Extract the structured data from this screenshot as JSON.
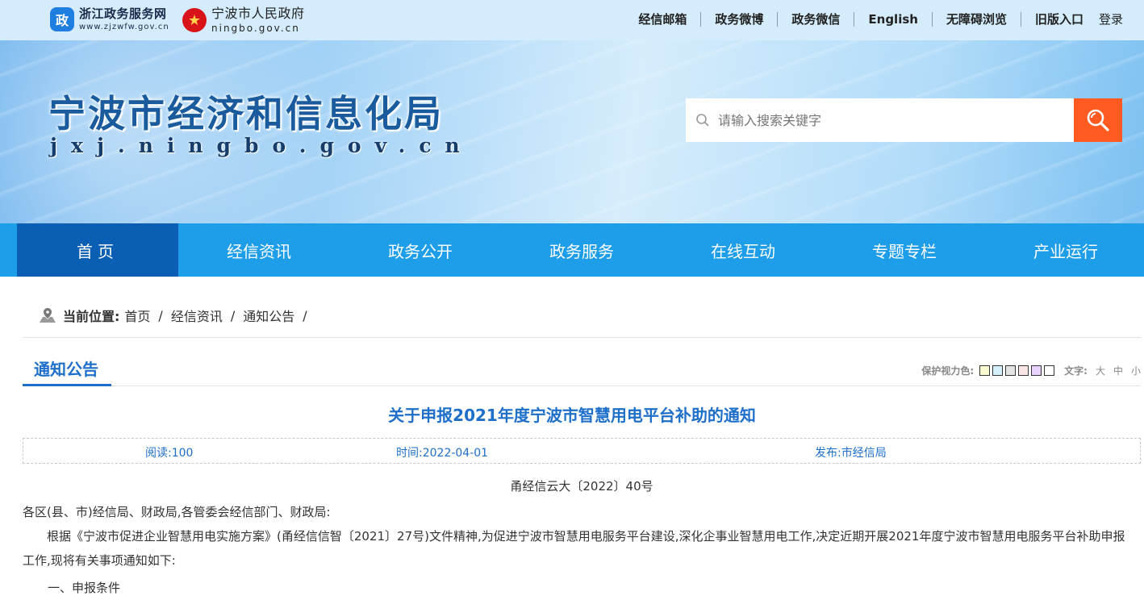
{
  "topbar": {
    "portal1": {
      "emblem": "政",
      "name": "浙江政务服务网",
      "domain": "www.zjzwfw.gov.cn"
    },
    "portal2": {
      "emblem": "★",
      "name": "宁波市人民政府",
      "domain": "ningbo.gov.cn"
    },
    "links": [
      "经信邮箱",
      "政务微博",
      "政务微信",
      "English",
      "无障碍浏览",
      "旧版入口"
    ],
    "login": "登录"
  },
  "banner": {
    "title": "宁波市经济和信息化局",
    "domain": "jxj.ningbo.gov.cn",
    "search_placeholder": "请输入搜索关键字"
  },
  "nav": {
    "items": [
      "首页",
      "经信资讯",
      "政务公开",
      "政务服务",
      "在线互动",
      "专题专栏",
      "产业运行"
    ],
    "active_index": 0
  },
  "breadcrumb": {
    "label": "当前位置:",
    "items": [
      "首页",
      "经信资讯",
      "通知公告"
    ]
  },
  "section": {
    "title": "通知公告",
    "eye_label": "保护视力色:",
    "eye_colors": [
      "#fafad2",
      "#d6f0fa",
      "#e4e4e4",
      "#fae6e6",
      "#e6d2fa",
      "#ffffff"
    ],
    "text_label": "文字:",
    "sizes": [
      "大",
      "中",
      "小"
    ]
  },
  "article": {
    "title": "关于申报2021年度宁波市智慧用电平台补助的通知",
    "reads": "阅读:100",
    "time": "时间:2022-04-01",
    "publisher": "发布:市经信局",
    "doc_no": "甬经信云大〔2022〕40号",
    "addressee": "各区(县、市)经信局、财政局,各管委会经信部门、财政局:",
    "body": "根据《宁波市促进企业智慧用电实施方案》(甬经信信智〔2021〕27号)文件精神,为促进宁波市智慧用电服务平台建设,深化企事业智慧用电工作,决定近期开展2021年度宁波市智慧用电服务平台补助申报工作,现将有关事项通知如下:",
    "heading1": "一、申报条件"
  },
  "colors": {
    "accent": "#1e6fc9",
    "nav_bg": "#1e9de8",
    "nav_active": "#0a5fb4",
    "search_btn": "#ff5a1f"
  }
}
